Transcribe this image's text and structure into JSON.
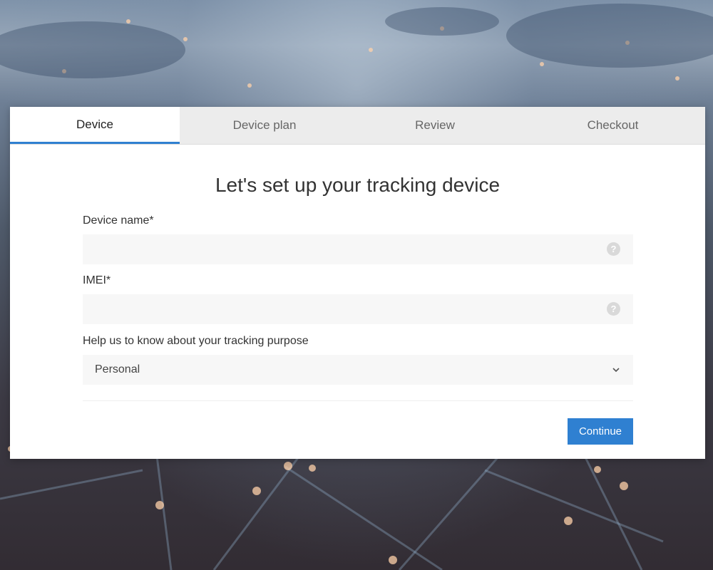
{
  "tabs": [
    {
      "label": "Device",
      "active": true
    },
    {
      "label": "Device plan",
      "active": false
    },
    {
      "label": "Review",
      "active": false
    },
    {
      "label": "Checkout",
      "active": false
    }
  ],
  "title": "Let's set up your tracking device",
  "form": {
    "device_name": {
      "label": "Device name*",
      "value": "",
      "help_icon": "question-circle-icon"
    },
    "imei": {
      "label": "IMEI*",
      "value": "",
      "help_icon": "question-circle-icon"
    },
    "purpose": {
      "label": "Help us to know about your tracking purpose",
      "selected": "Personal",
      "icon": "chevron-down-icon"
    }
  },
  "actions": {
    "continue_label": "Continue"
  },
  "colors": {
    "accent": "#2f80d1",
    "tab_bar": "#ececec",
    "field_bg": "#f7f7f7"
  }
}
